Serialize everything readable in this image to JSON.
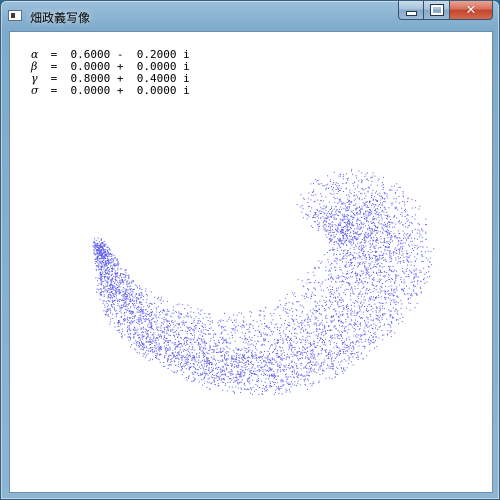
{
  "window": {
    "title": "畑政義写像",
    "minimize_label": "minimize",
    "maximize_label": "maximize",
    "close_glyph": "✕"
  },
  "parameters": [
    {
      "symbol": "α",
      "text": " =  0.6000 -  0.2000 i"
    },
    {
      "symbol": "β",
      "text": " =  0.0000 +  0.0000 i"
    },
    {
      "symbol": "γ",
      "text": " =  0.8000 +  0.4000 i"
    },
    {
      "symbol": "σ",
      "text": " =  0.0000 +  0.0000 i"
    }
  ],
  "plot": {
    "point_color": "#5b5bef",
    "background": "#ffffff"
  }
}
